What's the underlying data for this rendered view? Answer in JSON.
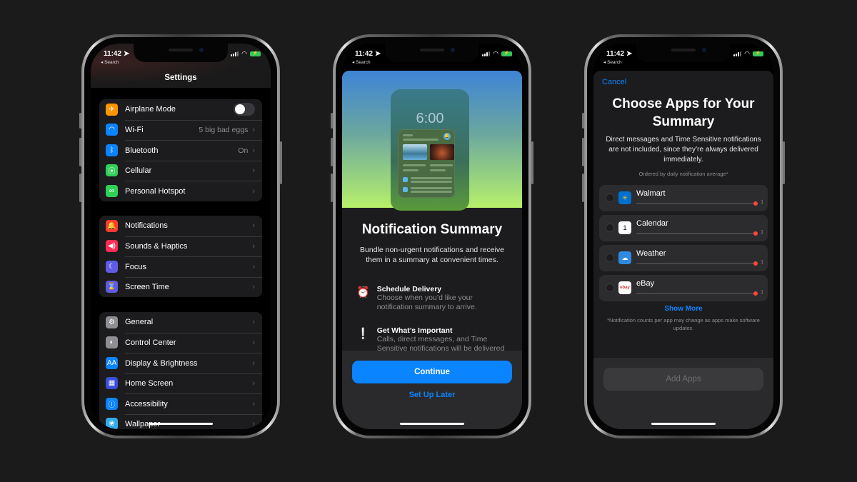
{
  "status": {
    "time": "11:42",
    "back_label": "◂ Search",
    "battery_glyph": "⚡"
  },
  "phone1": {
    "title": "Settings",
    "groups": [
      [
        {
          "label": "Airplane Mode",
          "value": "",
          "icon": "airplane-icon",
          "glyph": "✈",
          "color": "#ff9500",
          "toggle": false
        },
        {
          "label": "Wi-Fi",
          "value": "5 big bad eggs",
          "icon": "wifi-icon",
          "glyph": "◠",
          "color": "#0a84ff"
        },
        {
          "label": "Bluetooth",
          "value": "On",
          "icon": "bluetooth-icon",
          "glyph": "ᛒ",
          "color": "#0a84ff"
        },
        {
          "label": "Cellular",
          "value": "",
          "icon": "cellular-icon",
          "glyph": "⦿",
          "color": "#30d158"
        },
        {
          "label": "Personal Hotspot",
          "value": "",
          "icon": "hotspot-icon",
          "glyph": "∞",
          "color": "#30d158"
        }
      ],
      [
        {
          "label": "Notifications",
          "value": "",
          "icon": "notifications-icon",
          "glyph": "🔔",
          "color": "#ff3b30"
        },
        {
          "label": "Sounds & Haptics",
          "value": "",
          "icon": "sounds-icon",
          "glyph": "◀)",
          "color": "#ff2d55"
        },
        {
          "label": "Focus",
          "value": "",
          "icon": "moon-icon",
          "glyph": "☾",
          "color": "#5e5ce6"
        },
        {
          "label": "Screen Time",
          "value": "",
          "icon": "hourglass-icon",
          "glyph": "⌛",
          "color": "#5e5ce6"
        }
      ],
      [
        {
          "label": "General",
          "value": "",
          "icon": "gear-icon",
          "glyph": "⚙",
          "color": "#8e8e93"
        },
        {
          "label": "Control Center",
          "value": "",
          "icon": "control-center-icon",
          "glyph": "◐",
          "color": "#8e8e93"
        },
        {
          "label": "Display & Brightness",
          "value": "",
          "icon": "display-icon",
          "glyph": "AA",
          "color": "#0a84ff"
        },
        {
          "label": "Home Screen",
          "value": "",
          "icon": "home-screen-icon",
          "glyph": "▦",
          "color": "#3a4fd8"
        },
        {
          "label": "Accessibility",
          "value": "",
          "icon": "accessibility-icon",
          "glyph": "ⓘ",
          "color": "#0a84ff"
        },
        {
          "label": "Wallpaper",
          "value": "",
          "icon": "wallpaper-icon",
          "glyph": "❀",
          "color": "#32ade6"
        }
      ]
    ]
  },
  "phone2": {
    "mock_time": "6:00",
    "title": "Notification Summary",
    "description": "Bundle non-urgent notifications and receive them in a summary at convenient times.",
    "features": [
      {
        "title": "Schedule Delivery",
        "desc": "Choose when you’d like your notification summary to arrive.",
        "icon": "alarm-clock-icon",
        "glyph": "⏰",
        "color": "#ff453a"
      },
      {
        "title": "Get What’s Important",
        "desc": "Calls, direct messages, and Time Sensitive notifications will be delivered immediately.",
        "icon": "exclamation-bubble-icon",
        "glyph": "❕",
        "color": "#0a84ff"
      }
    ],
    "continue_label": "Continue",
    "later_label": "Set Up Later"
  },
  "phone3": {
    "cancel_label": "Cancel",
    "title": "Choose Apps for Your Summary",
    "description": "Direct messages and Time Sensitive notifications are not included, since they’re always delivered immediately.",
    "ordered_label": "Ordered by daily notification average*",
    "apps": [
      {
        "name": "Walmart",
        "count": "1",
        "icon": "walmart-icon",
        "glyph": "✳",
        "bg": "#0071ce",
        "fg": "#ffc220"
      },
      {
        "name": "Calendar",
        "count": "1",
        "icon": "calendar-icon",
        "glyph": "1",
        "bg": "#ffffff",
        "fg": "#000000"
      },
      {
        "name": "Weather",
        "count": "1",
        "icon": "weather-icon",
        "glyph": "☁",
        "bg": "#2f8be0",
        "fg": "#ffffff"
      },
      {
        "name": "eBay",
        "count": "1",
        "icon": "ebay-icon",
        "glyph": "ebay",
        "bg": "#ffffff",
        "fg": "#e53238"
      }
    ],
    "show_more_label": "Show More",
    "note": "*Notification counts per app may change as apps make software updates.",
    "add_apps_label": "Add Apps"
  }
}
